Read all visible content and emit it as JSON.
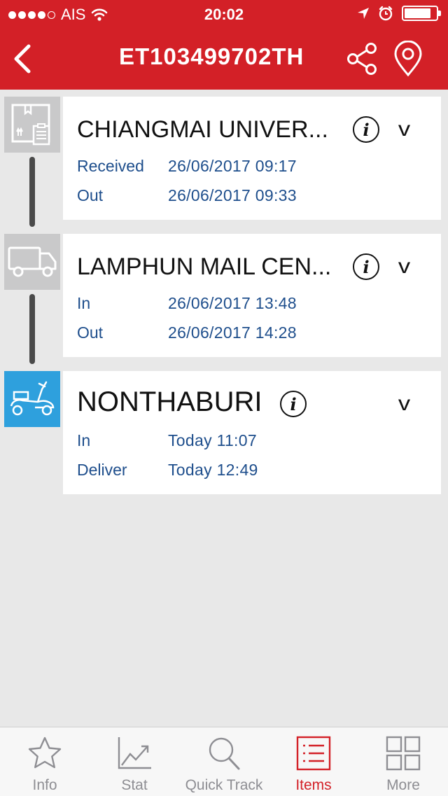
{
  "status": {
    "carrier": "AIS",
    "time": "20:02",
    "battery_level": 0.85
  },
  "header": {
    "title": "ET103499702TH"
  },
  "colors": {
    "brand_red": "#d32027",
    "link_blue": "#1e4e8c",
    "active_icon": "#2ea0dd"
  },
  "steps": [
    {
      "name": "CHIANGMAI UNIVER...",
      "icon": "package-icon",
      "active": false,
      "rows": [
        {
          "label": "Received",
          "value": "26/06/2017 09:17"
        },
        {
          "label": "Out",
          "value": "26/06/2017 09:33"
        }
      ]
    },
    {
      "name": "LAMPHUN MAIL CEN...",
      "icon": "truck-icon",
      "active": false,
      "rows": [
        {
          "label": "In",
          "value": "26/06/2017 13:48"
        },
        {
          "label": "Out",
          "value": "26/06/2017 14:28"
        }
      ]
    },
    {
      "name": "NONTHABURI",
      "icon": "scooter-icon",
      "active": true,
      "rows": [
        {
          "label": "In",
          "value": "Today 11:07"
        },
        {
          "label": "Deliver",
          "value": "Today 12:49"
        }
      ]
    }
  ],
  "tabs": [
    {
      "label": "Info",
      "icon": "star-icon"
    },
    {
      "label": "Stat",
      "icon": "chart-icon"
    },
    {
      "label": "Quick Track",
      "icon": "search-icon"
    },
    {
      "label": "Items",
      "icon": "list-icon",
      "active": true
    },
    {
      "label": "More",
      "icon": "grid-icon"
    }
  ]
}
